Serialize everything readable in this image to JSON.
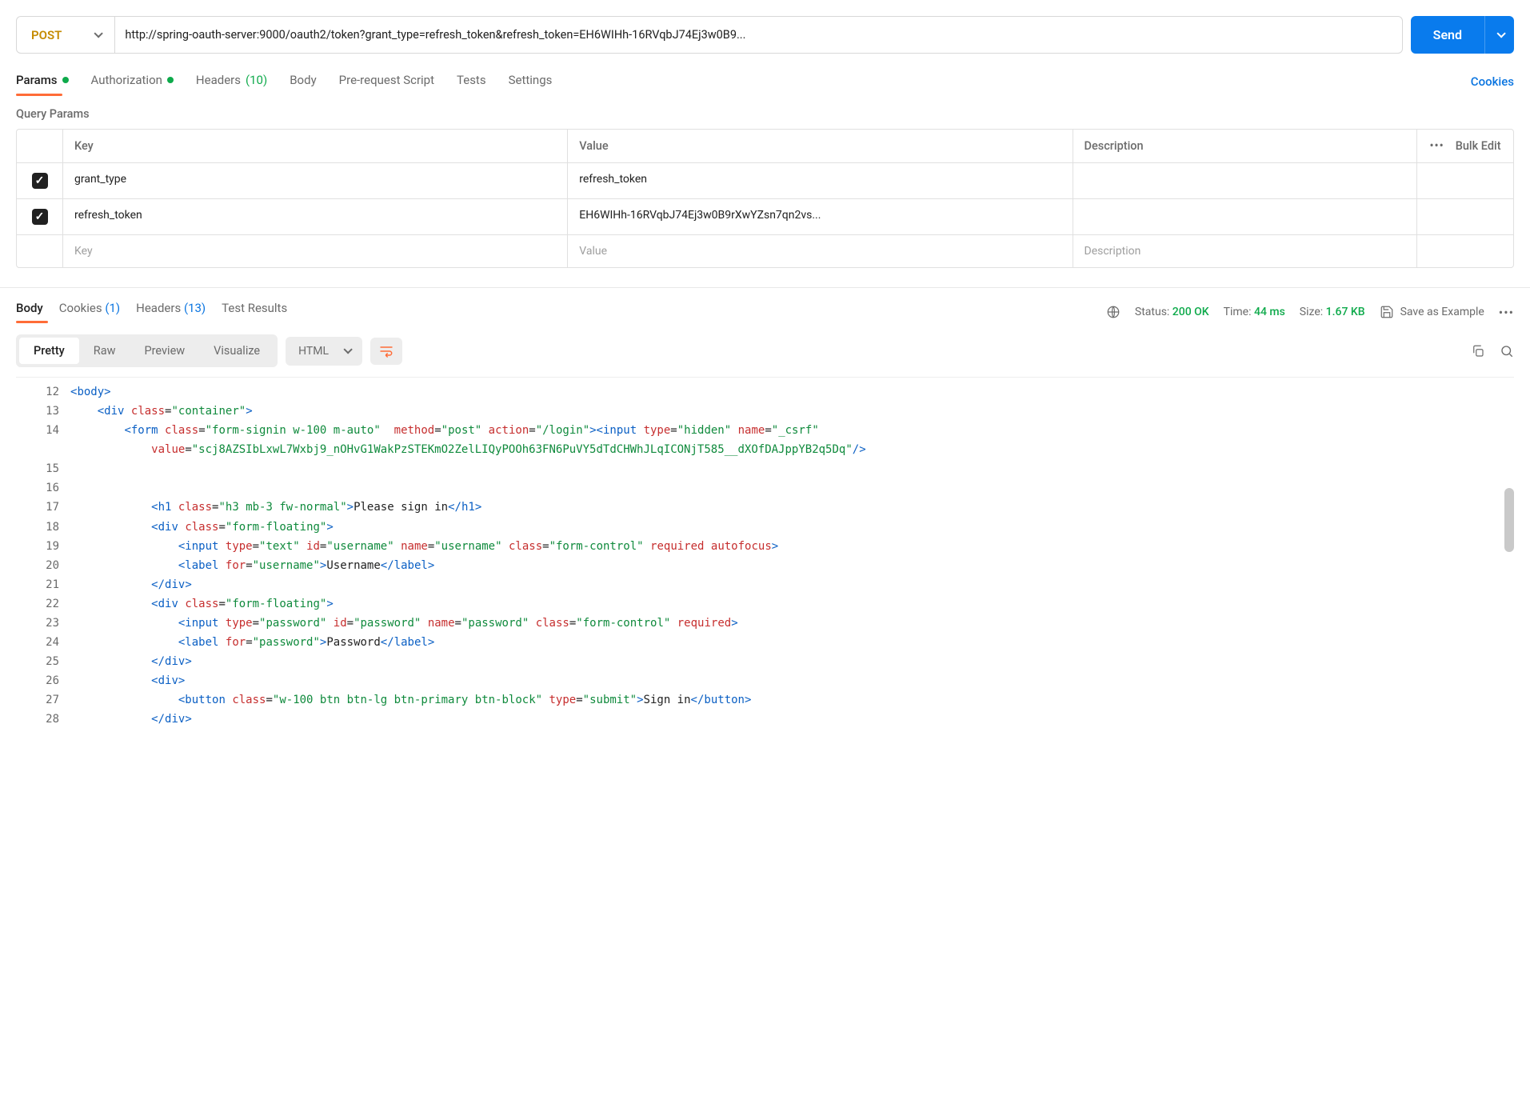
{
  "request": {
    "method": "POST",
    "url": "http://spring-oauth-server:9000/oauth2/token?grant_type=refresh_token&refresh_token=EH6WIHh-16RVqbJ74Ej3w0B9...",
    "send_label": "Send"
  },
  "tabs": {
    "params": "Params",
    "authorization": "Authorization",
    "headers": "Headers",
    "headers_count": "(10)",
    "body": "Body",
    "prerequest": "Pre-request Script",
    "tests": "Tests",
    "settings": "Settings",
    "cookies": "Cookies"
  },
  "query_params": {
    "title": "Query Params",
    "headers": {
      "key": "Key",
      "value": "Value",
      "description": "Description",
      "bulk_edit": "Bulk Edit"
    },
    "placeholders": {
      "key": "Key",
      "value": "Value",
      "description": "Description"
    },
    "rows": [
      {
        "key": "grant_type",
        "value": "refresh_token"
      },
      {
        "key": "refresh_token",
        "value": "EH6WIHh-16RVqbJ74Ej3w0B9rXwYZsn7qn2vs..."
      }
    ]
  },
  "response": {
    "tabs": {
      "body": "Body",
      "cookies": "Cookies",
      "cookies_count": "(1)",
      "headers": "Headers",
      "headers_count": "(13)",
      "test_results": "Test Results"
    },
    "status_label": "Status:",
    "status_value": "200 OK",
    "time_label": "Time:",
    "time_value": "44 ms",
    "size_label": "Size:",
    "size_value": "1.67 KB",
    "save_example": "Save as Example",
    "view_modes": {
      "pretty": "Pretty",
      "raw": "Raw",
      "preview": "Preview",
      "visualize": "Visualize"
    },
    "format": "HTML"
  },
  "code_lines": [
    {
      "n": 12,
      "html": "<span class='t-pun'>&lt;</span><span class='t-tag'>body</span><span class='t-pun'>&gt;</span>"
    },
    {
      "n": 13,
      "html": "    <span class='t-pun'>&lt;</span><span class='t-tag'>div</span> <span class='t-attr'>class</span>=<span class='t-str'>\"container\"</span><span class='t-pun'>&gt;</span>"
    },
    {
      "n": 14,
      "html": "        <span class='t-pun'>&lt;</span><span class='t-tag'>form</span> <span class='t-attr'>class</span>=<span class='t-str'>\"form-signin w-100 m-auto\"</span>  <span class='t-attr'>method</span>=<span class='t-str'>\"post\"</span> <span class='t-attr'>action</span>=<span class='t-str'>\"/login\"</span><span class='t-pun'>&gt;&lt;</span><span class='t-tag'>input</span> <span class='t-attr'>type</span>=<span class='t-str'>\"hidden\"</span> <span class='t-attr'>name</span>=<span class='t-str'>\"_csrf\"</span>\n            <span class='t-attr'>value</span>=<span class='t-str'>\"scj8AZSIbLxwL7Wxbj9_nOHvG1WakPzSTEKmO2ZelLIQyPOOh63FN6PuVY5dTdCHWhJLqICONjT585__dXOfDAJppYB2q5Dq\"</span><span class='t-pun'>/&gt;</span>"
    },
    {
      "n": 15,
      "html": ""
    },
    {
      "n": 16,
      "html": ""
    },
    {
      "n": 17,
      "html": "            <span class='t-pun'>&lt;</span><span class='t-tag'>h1</span> <span class='t-attr'>class</span>=<span class='t-str'>\"h3 mb-3 fw-normal\"</span><span class='t-pun'>&gt;</span><span class='t-txt'>Please sign in</span><span class='t-pun'>&lt;/</span><span class='t-tag'>h1</span><span class='t-pun'>&gt;</span>"
    },
    {
      "n": 18,
      "html": "            <span class='t-pun'>&lt;</span><span class='t-tag'>div</span> <span class='t-attr'>class</span>=<span class='t-str'>\"form-floating\"</span><span class='t-pun'>&gt;</span>"
    },
    {
      "n": 19,
      "html": "                <span class='t-pun'>&lt;</span><span class='t-tag'>input</span> <span class='t-attr'>type</span>=<span class='t-str'>\"text\"</span> <span class='t-attr'>id</span>=<span class='t-str'>\"username\"</span> <span class='t-attr'>name</span>=<span class='t-str'>\"username\"</span> <span class='t-attr'>class</span>=<span class='t-str'>\"form-control\"</span> <span class='t-attr'>required autofocus</span><span class='t-pun'>&gt;</span>"
    },
    {
      "n": 20,
      "html": "                <span class='t-pun'>&lt;</span><span class='t-tag'>label</span> <span class='t-attr'>for</span>=<span class='t-str'>\"username\"</span><span class='t-pun'>&gt;</span><span class='t-txt'>Username</span><span class='t-pun'>&lt;/</span><span class='t-tag'>label</span><span class='t-pun'>&gt;</span>"
    },
    {
      "n": 21,
      "html": "            <span class='t-pun'>&lt;/</span><span class='t-tag'>div</span><span class='t-pun'>&gt;</span>"
    },
    {
      "n": 22,
      "html": "            <span class='t-pun'>&lt;</span><span class='t-tag'>div</span> <span class='t-attr'>class</span>=<span class='t-str'>\"form-floating\"</span><span class='t-pun'>&gt;</span>"
    },
    {
      "n": 23,
      "html": "                <span class='t-pun'>&lt;</span><span class='t-tag'>input</span> <span class='t-attr'>type</span>=<span class='t-str'>\"password\"</span> <span class='t-attr'>id</span>=<span class='t-str'>\"password\"</span> <span class='t-attr'>name</span>=<span class='t-str'>\"password\"</span> <span class='t-attr'>class</span>=<span class='t-str'>\"form-control\"</span> <span class='t-attr'>required</span><span class='t-pun'>&gt;</span>"
    },
    {
      "n": 24,
      "html": "                <span class='t-pun'>&lt;</span><span class='t-tag'>label</span> <span class='t-attr'>for</span>=<span class='t-str'>\"password\"</span><span class='t-pun'>&gt;</span><span class='t-txt'>Password</span><span class='t-pun'>&lt;/</span><span class='t-tag'>label</span><span class='t-pun'>&gt;</span>"
    },
    {
      "n": 25,
      "html": "            <span class='t-pun'>&lt;/</span><span class='t-tag'>div</span><span class='t-pun'>&gt;</span>"
    },
    {
      "n": 26,
      "html": "            <span class='t-pun'>&lt;</span><span class='t-tag'>div</span><span class='t-pun'>&gt;</span>"
    },
    {
      "n": 27,
      "html": "                <span class='t-pun'>&lt;</span><span class='t-tag'>button</span> <span class='t-attr'>class</span>=<span class='t-str'>\"w-100 btn btn-lg btn-primary btn-block\"</span> <span class='t-attr'>type</span>=<span class='t-str'>\"submit\"</span><span class='t-pun'>&gt;</span><span class='t-txt'>Sign in</span><span class='t-pun'>&lt;/</span><span class='t-tag'>button</span><span class='t-pun'>&gt;</span>"
    },
    {
      "n": 28,
      "html": "            <span class='t-pun'>&lt;/</span><span class='t-tag'>div</span><span class='t-pun'>&gt;</span>"
    }
  ]
}
